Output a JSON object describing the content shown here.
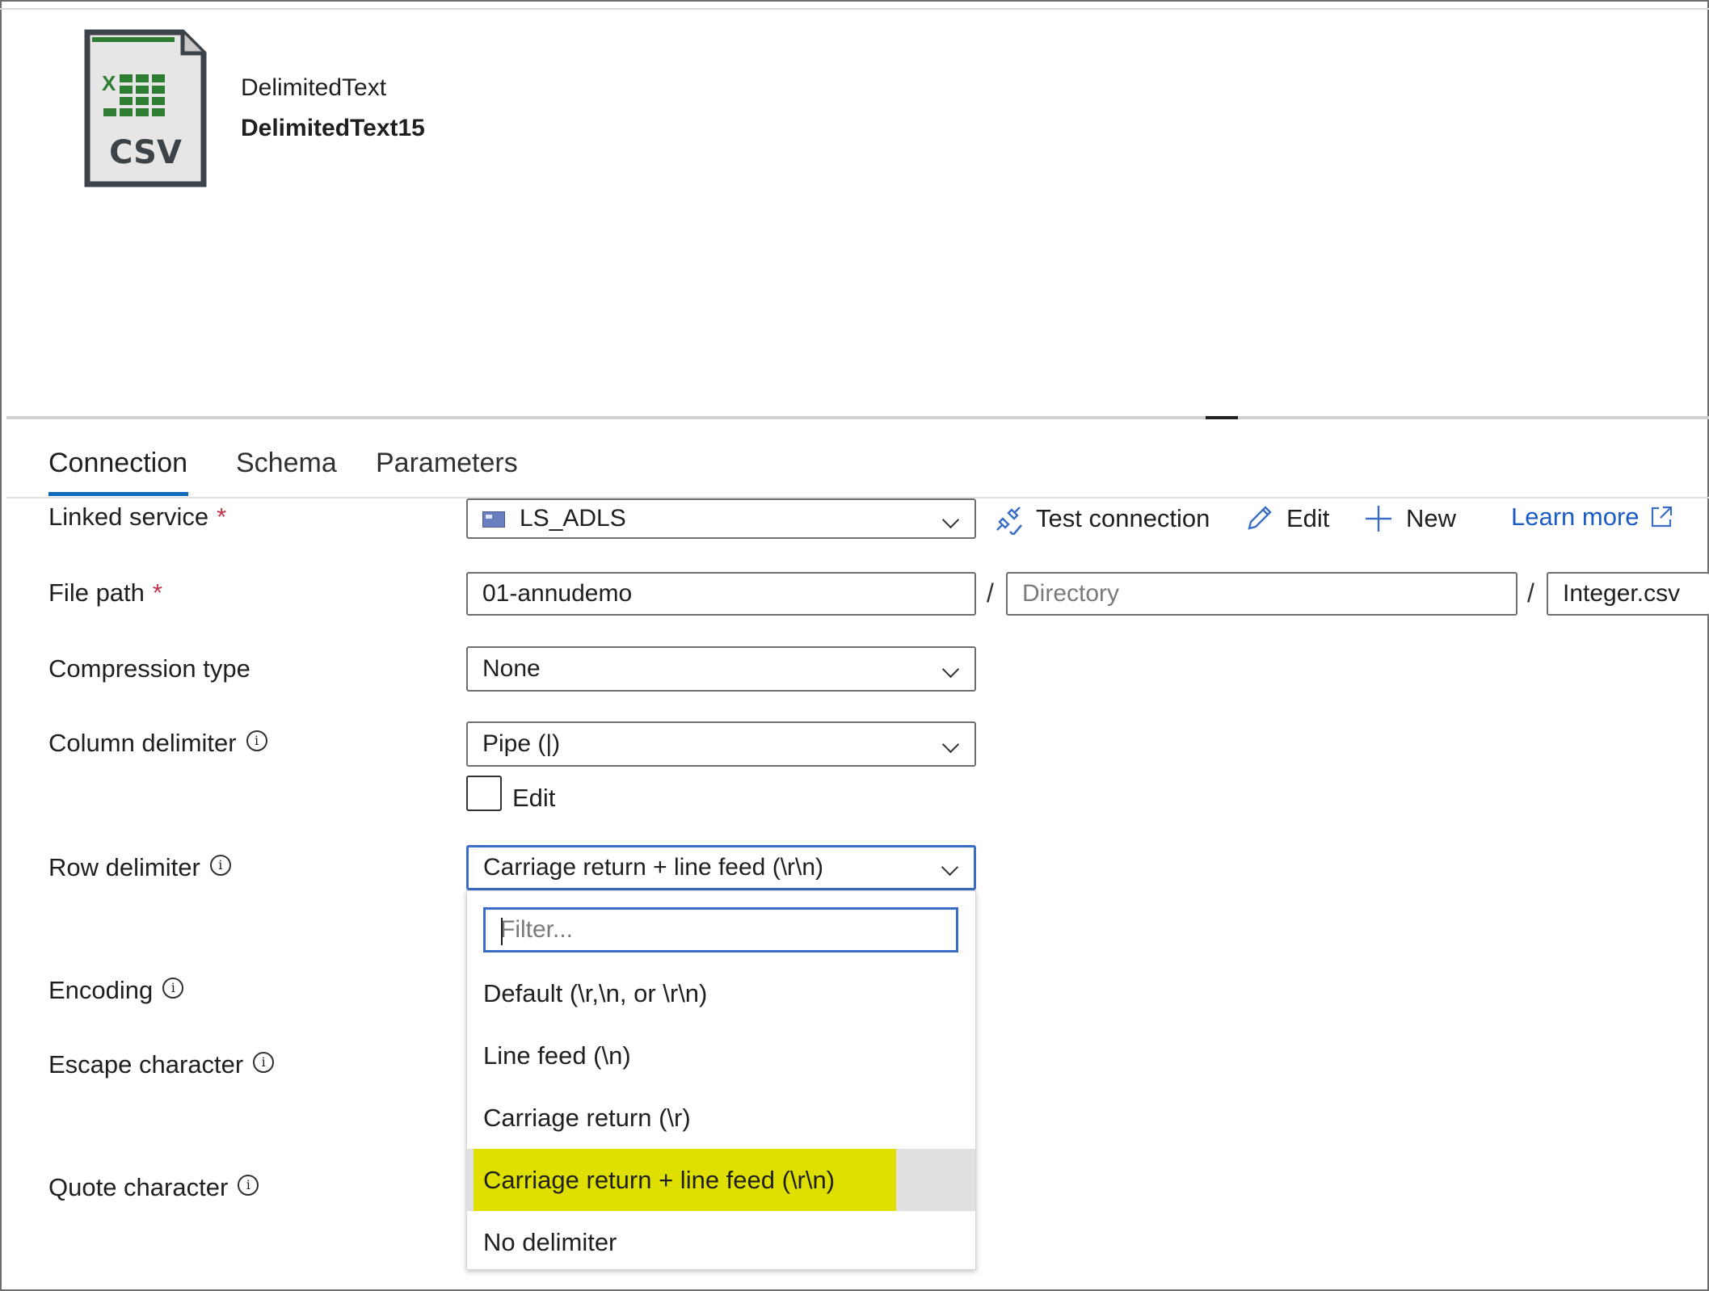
{
  "header": {
    "icon_text": "CSV",
    "icon_letter": "X",
    "type_label": "DelimitedText",
    "dataset_name": "DelimitedText15"
  },
  "tabs": [
    {
      "label": "Connection",
      "active": true
    },
    {
      "label": "Schema",
      "active": false
    },
    {
      "label": "Parameters",
      "active": false
    }
  ],
  "linked_service": {
    "label": "Linked service",
    "required": "*",
    "value": "LS_ADLS",
    "test_connection": "Test connection",
    "edit": "Edit",
    "new": "New",
    "learn_more": "Learn more"
  },
  "file_path": {
    "label": "File path",
    "required": "*",
    "container": "01-annudemo",
    "separator": "/",
    "directory_placeholder": "Directory",
    "file_name": "Integer.csv"
  },
  "compression": {
    "label": "Compression type",
    "value": "None"
  },
  "column_delimiter": {
    "label": "Column delimiter",
    "value": "Pipe (|)",
    "edit_label": "Edit"
  },
  "row_delimiter": {
    "label": "Row delimiter",
    "value": "Carriage return + line feed (\\r\\n)",
    "filter_placeholder": "Filter...",
    "options": [
      "Default (\\r,\\n, or \\r\\n)",
      "Line feed (\\n)",
      "Carriage return (\\r)",
      "Carriage return + line feed (\\r\\n)",
      "No delimiter"
    ],
    "selected_index": 3
  },
  "encoding": {
    "label": "Encoding"
  },
  "escape_character": {
    "label": "Escape character"
  },
  "quote_character": {
    "label": "Quote character"
  },
  "info_glyph": "i",
  "colors": {
    "accent": "#0f6cbd",
    "focus_border": "#3a6dc5",
    "highlight": "#e0e000",
    "link": "#1a5bc4",
    "required": "#c4314b"
  }
}
